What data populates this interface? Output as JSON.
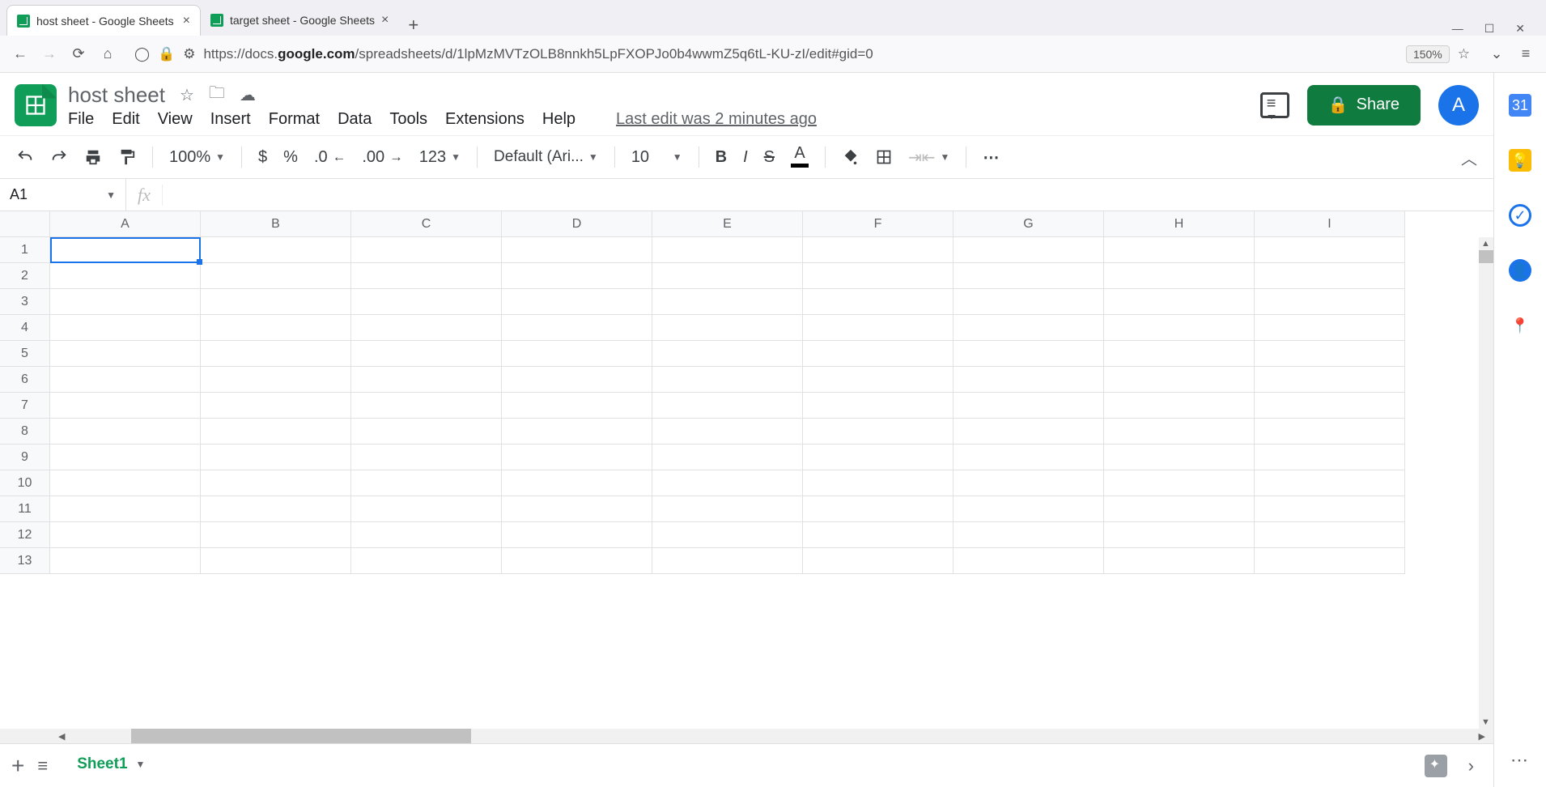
{
  "browser": {
    "tabs": [
      {
        "title": "host sheet - Google Sheets",
        "active": true
      },
      {
        "title": "target sheet - Google Sheets",
        "active": false
      }
    ],
    "url_prefix": "https://docs.",
    "url_bold": "google.com",
    "url_suffix": "/spreadsheets/d/1lpMzMVTzOLB8nnkh5LpFXOPJo0b4wwmZ5q6tL-KU-zI/edit#gid=0",
    "zoom": "150%"
  },
  "doc": {
    "title": "host sheet",
    "menus": [
      "File",
      "Edit",
      "View",
      "Insert",
      "Format",
      "Data",
      "Tools",
      "Extensions",
      "Help"
    ],
    "last_edit": "Last edit was 2 minutes ago",
    "share_label": "Share",
    "avatar_letter": "A"
  },
  "toolbar": {
    "zoom": "100%",
    "currency": "$",
    "percent": "%",
    "dec_dec": ".0",
    "inc_dec": ".00",
    "format_num": "123",
    "font": "Default (Ari...",
    "font_size": "10"
  },
  "namebox": {
    "ref": "A1"
  },
  "columns": [
    "A",
    "B",
    "C",
    "D",
    "E",
    "F",
    "G",
    "H",
    "I"
  ],
  "rows": [
    1,
    2,
    3,
    4,
    5,
    6,
    7,
    8,
    9,
    10,
    11,
    12,
    13
  ],
  "sheet_tab": "Sheet1",
  "sidepanel": {
    "calendar_day": "31"
  }
}
